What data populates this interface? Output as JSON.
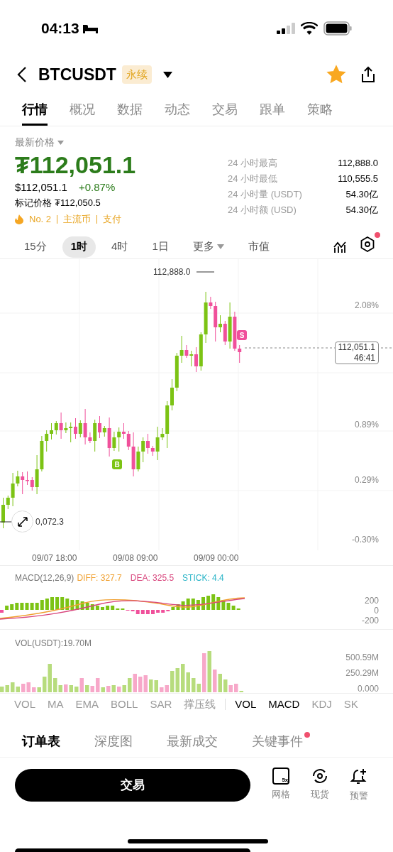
{
  "status_bar": {
    "time": "04:13"
  },
  "header": {
    "symbol": "BTCUSDT",
    "badge": "永续",
    "favorite": true
  },
  "tabs": [
    {
      "label": "行情",
      "selected": true
    },
    {
      "label": "概况",
      "selected": false
    },
    {
      "label": "数据",
      "selected": false
    },
    {
      "label": "动态",
      "selected": false
    },
    {
      "label": "交易",
      "selected": false
    },
    {
      "label": "跟单",
      "selected": false
    },
    {
      "label": "策略",
      "selected": false
    }
  ],
  "price": {
    "label": "最新价格",
    "last": "₮112,051.1",
    "usd": "$112,051.1",
    "change": "+0.87%",
    "mark_label": "标记价格",
    "mark_value": "₮112,050.5",
    "tags": [
      "No. 2",
      "主流币",
      "支付"
    ]
  },
  "stats": [
    {
      "label": "24 小时最高",
      "value": "112,888.0"
    },
    {
      "label": "24 小时最低",
      "value": "110,555.5"
    },
    {
      "label": "24 小时量 (USDT)",
      "value": "54.30亿"
    },
    {
      "label": "24 小时额 (USD)",
      "value": "54.30亿"
    }
  ],
  "timeframes": [
    {
      "label": "15分",
      "selected": false,
      "kind": "option"
    },
    {
      "label": "1时",
      "selected": true,
      "kind": "option"
    },
    {
      "label": "4时",
      "selected": false,
      "kind": "option"
    },
    {
      "label": "1日",
      "selected": false,
      "kind": "option"
    },
    {
      "label": "更多",
      "selected": false,
      "kind": "dropdown"
    },
    {
      "label": "市值",
      "selected": false,
      "kind": "option"
    }
  ],
  "settings_alert": true,
  "chart": {
    "high_label": "112,888.0",
    "low_label": "0,072.3",
    "y_labels": [
      "2.08%",
      "0.89%",
      "0.29%",
      "-0.30%"
    ],
    "price_tag": "112,051.1",
    "countdown": "46:41",
    "x_labels": [
      "09/07 18:00",
      "09/08 09:00",
      "09/09 00:00"
    ],
    "buy_marker": "B",
    "sell_marker": "S"
  },
  "macd": {
    "title": "MACD(12,26,9)",
    "diff": "DIFF: 327.7",
    "dea": "DEA: 325.5",
    "stick": "STICK: 4.4",
    "y_labels": [
      "200",
      "0",
      "-200"
    ]
  },
  "volume": {
    "title": "VOL(USDT):19.70M",
    "y_labels": [
      "500.59M",
      "250.29M",
      "0.000"
    ]
  },
  "main_indicators": [
    {
      "label": "VOL",
      "selected": false
    },
    {
      "label": "MA",
      "selected": false
    },
    {
      "label": "EMA",
      "selected": false
    },
    {
      "label": "BOLL",
      "selected": false
    },
    {
      "label": "SAR",
      "selected": false
    },
    {
      "label": "撑压线",
      "selected": false
    }
  ],
  "sub_indicators": [
    {
      "label": "VOL",
      "selected": true
    },
    {
      "label": "MACD",
      "selected": true
    },
    {
      "label": "KDJ",
      "selected": false
    },
    {
      "label": "SK",
      "selected": false
    }
  ],
  "order_tabs": [
    {
      "label": "订单表",
      "selected": true,
      "alert": false
    },
    {
      "label": "深度图",
      "selected": false,
      "alert": false
    },
    {
      "label": "最新成交",
      "selected": false,
      "alert": false
    },
    {
      "label": "关键事件",
      "selected": false,
      "alert": true
    }
  ],
  "bottom": {
    "trade_button": "交易",
    "actions": [
      {
        "label": "网格",
        "kind": "grid",
        "icon_text": "5x"
      },
      {
        "label": "现货",
        "kind": "spot"
      },
      {
        "label": "预警",
        "kind": "alert"
      }
    ]
  }
}
